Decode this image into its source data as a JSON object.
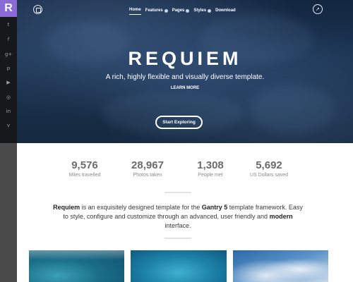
{
  "brand": {
    "logo_letter": "R"
  },
  "social_icons": [
    {
      "name": "twitter-icon",
      "glyph": "t"
    },
    {
      "name": "facebook-icon",
      "glyph": "f"
    },
    {
      "name": "google-plus-icon",
      "glyph": "g+"
    },
    {
      "name": "pinterest-icon",
      "glyph": "p"
    },
    {
      "name": "youtube-icon",
      "glyph": "▶"
    },
    {
      "name": "instagram-icon",
      "glyph": "◎"
    },
    {
      "name": "linkedin-icon",
      "glyph": "in"
    },
    {
      "name": "vimeo-icon",
      "glyph": "v"
    }
  ],
  "nav": {
    "items": [
      {
        "label": "Home",
        "active": true,
        "has_dropdown": false
      },
      {
        "label": "Features",
        "active": false,
        "has_dropdown": true
      },
      {
        "label": "Pages",
        "active": false,
        "has_dropdown": true
      },
      {
        "label": "Styles",
        "active": false,
        "has_dropdown": true
      },
      {
        "label": "Download",
        "active": false,
        "has_dropdown": false
      }
    ]
  },
  "hero": {
    "title": "REQUIEM",
    "subtitle": "A rich, highly flexible and visually diverse template.",
    "learn_more": "LEARN MORE",
    "cta": "Start Exploring"
  },
  "stats": [
    {
      "value": "9,576",
      "label": "Miles travelled"
    },
    {
      "value": "28,967",
      "label": "Photos taken"
    },
    {
      "value": "1,308",
      "label": "People met"
    },
    {
      "value": "5,692",
      "label": "US Dollars saved"
    }
  ],
  "intro": {
    "part1": "Requiem",
    "part2": " is an exquisitely designed template for the ",
    "part3": "Gantry 5",
    "part4": " template framework. Easy to style, configure and customize through an advanced, user friendly and ",
    "part5": "modern",
    "part6": " interface."
  },
  "colors": {
    "accent": "#8a6ad6",
    "sidebar": "#17181c",
    "hero_bg": "#1c3453"
  }
}
